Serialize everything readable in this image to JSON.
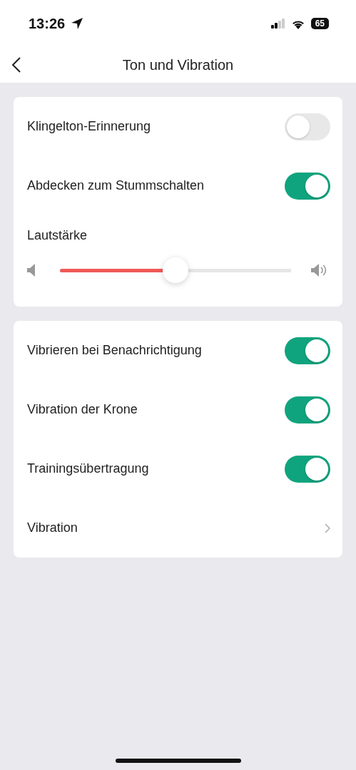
{
  "status_bar": {
    "time": "13:26",
    "battery": "65"
  },
  "header": {
    "title": "Ton und Vibration"
  },
  "sound_card": {
    "rows": [
      {
        "label": "Klingelton-Erinnerung",
        "on": false
      },
      {
        "label": "Abdecken zum Stummschalten",
        "on": true
      }
    ],
    "volume": {
      "label": "Lautstärke",
      "level": 0.5
    }
  },
  "vibration_card": {
    "rows": [
      {
        "kind": "toggle",
        "label": "Vibrieren bei Benachrichtigung",
        "on": true
      },
      {
        "kind": "toggle",
        "label": "Vibration der Krone",
        "on": true
      },
      {
        "kind": "toggle",
        "label": "Trainingsübertragung",
        "on": true
      },
      {
        "kind": "link",
        "label": "Vibration"
      }
    ]
  }
}
